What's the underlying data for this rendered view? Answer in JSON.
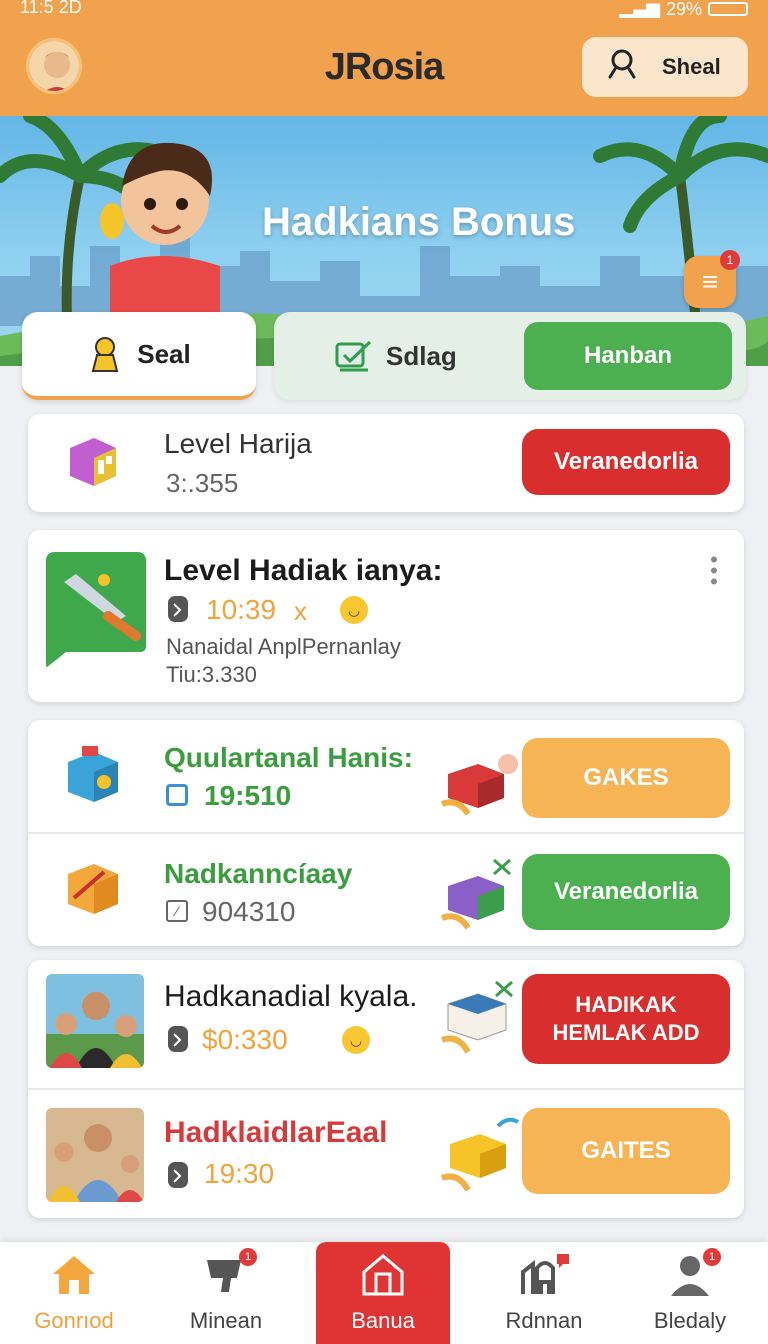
{
  "status": {
    "time": "11:5 2D",
    "battery": "29%"
  },
  "header": {
    "title": "JRosia",
    "search_label": "Sheal"
  },
  "banner": {
    "title": "Hadkians Bonus",
    "chat_badge_count": "1"
  },
  "tabs": {
    "seal": "Seal",
    "sdlag": "Sdlag",
    "hanban": "Hanban"
  },
  "rows": [
    {
      "title": "Level Harija",
      "sub": "3:.355",
      "button": "Veranedorlia"
    },
    {
      "title": "Level Hadiak ianya:",
      "time": "10:39",
      "time_suffix": "x",
      "line1": "Nanaidal AnplPernanlay",
      "line2": "Tiu:3.330"
    },
    {
      "title": "Quulartanal Hanis:",
      "time": "19:510",
      "button": "GAKES"
    },
    {
      "title": "Nadkanncíaay",
      "time": "904310",
      "button": "Veranedorlia"
    },
    {
      "title": "Hadkanadial kyala.",
      "time": "$0:330",
      "button_line1": "HADIKAK",
      "button_line2": "HEMLAK ADD"
    },
    {
      "title": "HadklaidlarEaal",
      "time": "19:30",
      "button": "GAITES"
    }
  ],
  "nav": [
    {
      "label": "Gonrıod"
    },
    {
      "label": "Minean",
      "badge": "1"
    },
    {
      "label": "Banua"
    },
    {
      "label": "Rdnnan"
    },
    {
      "label": "Bledaly",
      "badge": "1"
    }
  ],
  "colors": {
    "brand_orange": "#f2a24c",
    "green": "#4caf50",
    "red": "#d82e2e",
    "light_orange": "#f7b454"
  }
}
